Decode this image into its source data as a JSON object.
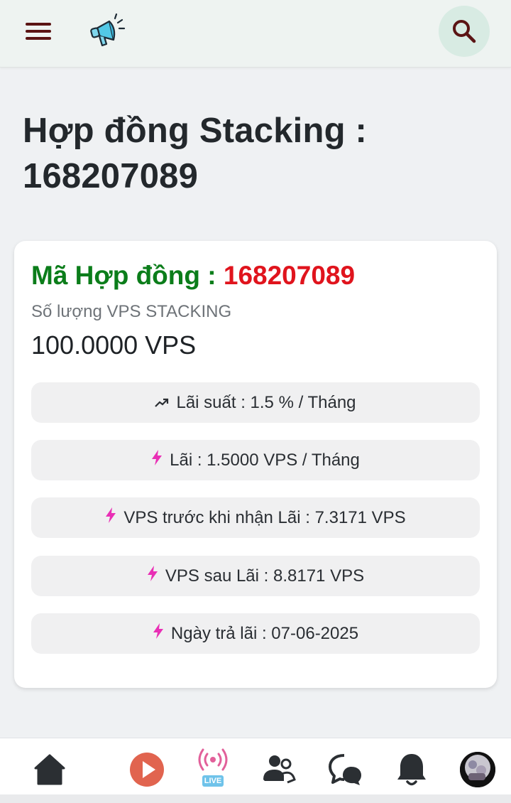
{
  "header": {
    "menu_icon": "hamburger-menu-icon",
    "announcement_icon": "megaphone-icon",
    "search_icon": "search-icon"
  },
  "page": {
    "title": "Hợp đồng Stacking : 168207089"
  },
  "contract": {
    "code_label": "Mã Hợp đồng : ",
    "code_value": "168207089",
    "quantity_label": "Số lượng VPS STACKING",
    "quantity_value": "100.0000 VPS",
    "details": [
      {
        "icon": "trending-up-icon",
        "text": "Lãi suất : 1.5 % / Tháng"
      },
      {
        "icon": "lightning-icon",
        "text": "Lãi : 1.5000 VPS / Tháng"
      },
      {
        "icon": "lightning-icon",
        "text": "VPS trước khi nhận Lãi : 7.3171 VPS"
      },
      {
        "icon": "lightning-icon",
        "text": "VPS sau Lãi : 8.8171 VPS"
      },
      {
        "icon": "lightning-icon",
        "text": "Ngày trả lãi : 07-06-2025"
      }
    ]
  },
  "bottom_nav": {
    "live_label": "LIVE",
    "items": [
      "home-icon",
      "play-icon",
      "live-icon",
      "friends-icon",
      "chat-icon",
      "bell-icon",
      "avatar"
    ]
  },
  "colors": {
    "contract_label": "#0b7d1a",
    "contract_value": "#e0141d",
    "accent_icon": "#e92fb5",
    "menu_dark_red": "#5b1414"
  }
}
